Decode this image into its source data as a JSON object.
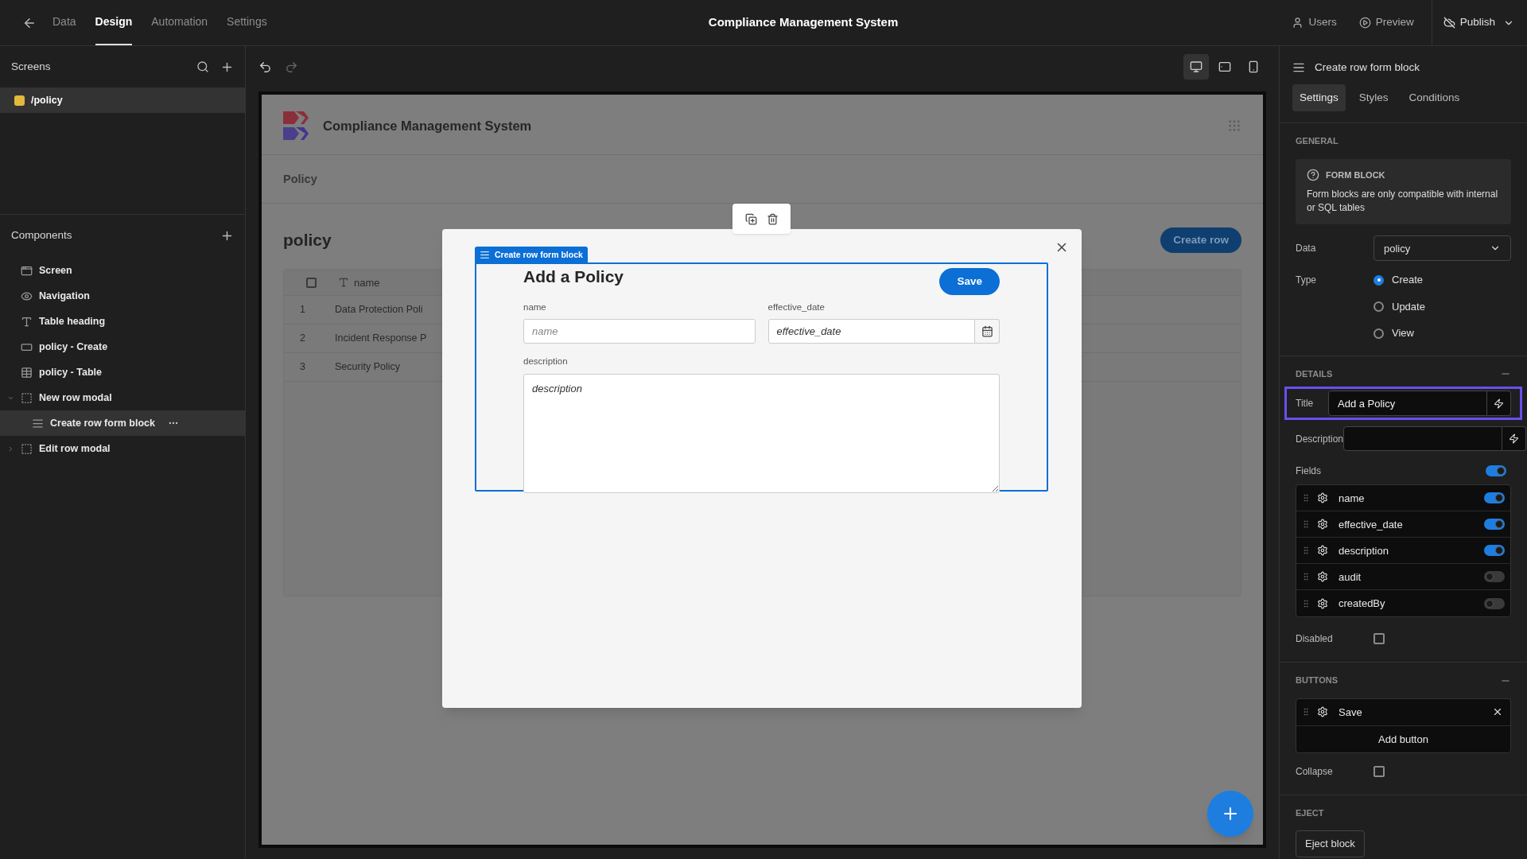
{
  "topbar": {
    "tabs": [
      {
        "label": "Data",
        "selected": false
      },
      {
        "label": "Design",
        "selected": true
      },
      {
        "label": "Automation",
        "selected": false
      },
      {
        "label": "Settings",
        "selected": false
      }
    ],
    "title": "Compliance Management System",
    "users": "Users",
    "preview": "Preview",
    "publish": "Publish"
  },
  "screens": {
    "title": "Screens",
    "items": [
      {
        "label": "/policy",
        "selected": true,
        "color": "#e2b93b"
      }
    ]
  },
  "components": {
    "title": "Components",
    "items": [
      {
        "label": "Screen",
        "kind": "screen",
        "selected": false
      },
      {
        "label": "Navigation",
        "kind": "navigation",
        "selected": false
      },
      {
        "label": "Table heading",
        "kind": "heading",
        "selected": false
      },
      {
        "label": "policy - Create",
        "kind": "button",
        "selected": false
      },
      {
        "label": "policy - Table",
        "kind": "table",
        "selected": false
      },
      {
        "label": "New row modal",
        "kind": "modal",
        "selected": false,
        "expanded": true,
        "children": [
          {
            "label": "Create row form block",
            "kind": "form",
            "selected": true
          }
        ]
      },
      {
        "label": "Edit row modal",
        "kind": "modal",
        "selected": false,
        "expanded": false
      }
    ]
  },
  "devices": [
    {
      "kind": "desktop",
      "selected": true
    },
    {
      "kind": "tablet",
      "selected": false
    },
    {
      "kind": "mobile",
      "selected": false
    }
  ],
  "app": {
    "title": "Compliance Management System",
    "nav": [
      "Policy"
    ],
    "heading": "policy",
    "create_button": "Create row",
    "table": {
      "select_all_checked": false,
      "columns": [
        "name"
      ],
      "rows": [
        {
          "index": "1",
          "name": "Data Protection Poli"
        },
        {
          "index": "2",
          "name": "Incident Response P"
        },
        {
          "index": "3",
          "name": "Security Policy"
        }
      ]
    }
  },
  "modal": {
    "block_label": "Create row form block",
    "title": "Add a Policy",
    "save": "Save",
    "fields": [
      {
        "label": "name",
        "placeholder": "name",
        "kind": "text"
      },
      {
        "label": "effective_date",
        "placeholder": "effective_date",
        "kind": "date"
      },
      {
        "label": "description",
        "placeholder": "description",
        "kind": "textarea"
      }
    ]
  },
  "panel": {
    "title": "Create row form block",
    "tabs": [
      {
        "label": "Settings",
        "selected": true
      },
      {
        "label": "Styles",
        "selected": false
      },
      {
        "label": "Conditions",
        "selected": false
      }
    ],
    "general": {
      "heading": "GENERAL",
      "info_title": "FORM BLOCK",
      "info_text": "Form blocks are only compatible with internal or SQL tables",
      "data_label": "Data",
      "data_value": "policy",
      "type_label": "Type",
      "types": [
        {
          "label": "Create",
          "selected": true
        },
        {
          "label": "Update",
          "selected": false
        },
        {
          "label": "View",
          "selected": false
        }
      ]
    },
    "details": {
      "heading": "DETAILS",
      "title_label": "Title",
      "title_value": "Add a Policy",
      "title_highlighted": true,
      "description_label": "Description",
      "fields_label": "Fields",
      "fields_on": true,
      "fields": [
        {
          "label": "name",
          "on": true
        },
        {
          "label": "effective_date",
          "on": true
        },
        {
          "label": "description",
          "on": true
        },
        {
          "label": "audit",
          "on": false
        },
        {
          "label": "createdBy",
          "on": false
        }
      ],
      "disabled_label": "Disabled",
      "disabled_checked": false
    },
    "buttons": {
      "heading": "BUTTONS",
      "items": [
        "Save"
      ],
      "add": "Add button",
      "collapse_label": "Collapse",
      "collapse_checked": false
    },
    "eject": {
      "heading": "EJECT",
      "button": "Eject block"
    }
  }
}
